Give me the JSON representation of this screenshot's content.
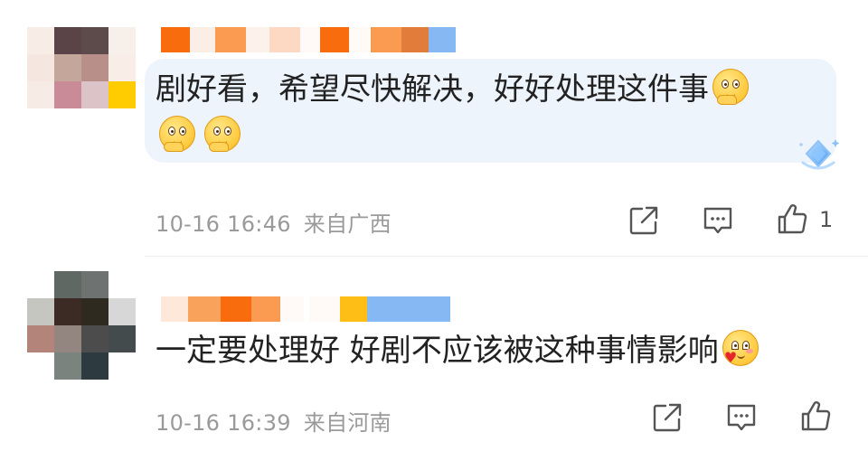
{
  "comments": [
    {
      "text": "剧好看，希望尽快解决，好好处理这件事",
      "text_line2": "",
      "emoji": [
        "thinking-face-emoji",
        "thinking-face-emoji",
        "thinking-face-emoji"
      ],
      "timestamp": "10-16 16:46",
      "location": "来自广西",
      "like_count": "1",
      "pixelated_colors": {
        "avatar": [
          "#f7ece6",
          "#5a4447",
          "#5d4a4b",
          "#f7efe9",
          "#f5e6df",
          "#c4a69b",
          "#b89089",
          "#f8eee7",
          "#f7ebe6",
          "#c98b97",
          "#dcc3c8",
          "#ffcc02"
        ],
        "username": [
          "#f86c0e",
          "#fbeee6",
          "#fa9b51",
          "#fdf1ec",
          "#fdd9c4",
          "#fffaf8",
          "#f86c0e",
          "#fffaf5",
          "#fa9b51",
          "#e27c3b",
          "#86b9f3"
        ]
      }
    },
    {
      "text": "一定要处理好 好剧不应该被这种事情影响",
      "emoji": [
        "heart-hands-face-emoji"
      ],
      "timestamp": "10-16 16:39",
      "location": "来自河南",
      "like_count": "",
      "pixelated_colors": {
        "avatar": [
          "#ffffff",
          "#5f6862",
          "#6e7270",
          "#ffffff",
          "#c6c6c0",
          "#3c2b24",
          "#2f2a1f",
          "#d7d7d7",
          "#b38479",
          "#938680",
          "#4c4c4c",
          "#434b4d",
          "#ffffff",
          "#7b837e",
          "#2d3b40",
          "#ffffff"
        ],
        "username": [
          "#fde8da",
          "#f9a25c",
          "#f86c0e",
          "#fa9b51",
          "#fffaf8",
          "#ffffff",
          "#fffaf8",
          "#fffaf5",
          "#ffbe15",
          "#86b9f3",
          "#86b9f3"
        ]
      }
    }
  ],
  "icons": {
    "share": "share-icon",
    "reply": "comment-icon",
    "like": "thumbs-up-icon",
    "badge": "diamond-badge-icon"
  },
  "colors": {
    "bubble": "#eef4fc",
    "meta_text": "#9a9a9a",
    "divider": "#ececec"
  }
}
